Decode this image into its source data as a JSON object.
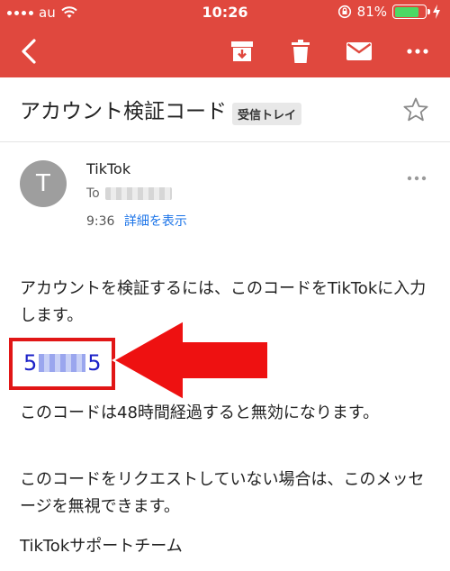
{
  "status": {
    "carrier": "au",
    "time": "10:26",
    "battery": "81%",
    "battery_level": 0.81
  },
  "toolbar": {
    "back_icon": "chevron-left-icon",
    "archive_icon": "archive-icon",
    "delete_icon": "trash-icon",
    "mail_icon": "envelope-icon",
    "more_icon": "more-horizontal-icon"
  },
  "email": {
    "subject": "アカウント検証コード",
    "label": "受信トレイ",
    "avatar_initial": "T",
    "sender": "TikTok",
    "to_prefix": "To",
    "time": "9:36",
    "details_link": "詳細を表示",
    "body": {
      "p1": "アカウントを検証するには、このコードをTikTokに入力します。",
      "code_start": "5",
      "code_end": "5",
      "p2": "このコードは48時間経過すると無効になります。",
      "p3": "このコードをリクエストしていない場合は、このメッセージを無視できます。",
      "p4": "TikTokサポートチーム"
    }
  },
  "colors": {
    "appbar": "#e0483e",
    "highlight": "#e11616",
    "code": "#1c22c8",
    "link": "#1a73e8"
  }
}
